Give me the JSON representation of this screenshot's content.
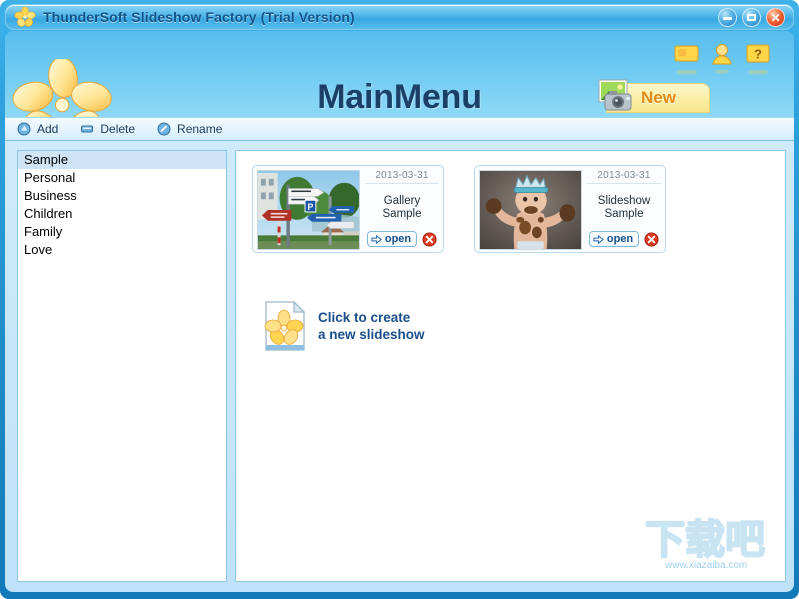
{
  "window": {
    "title": "ThunderSoft Slideshow Factory (Trial Version)",
    "logo_icon": "flower-logo-icon",
    "controls": {
      "minimize": "minimize-button",
      "maximize": "maximize-button",
      "close": "close-button"
    }
  },
  "header": {
    "title": "MainMenu",
    "logo_icon": "flower-logo-large-icon",
    "icons": [
      {
        "name": "notes-icon",
        "label": "Notes"
      },
      {
        "name": "user-icon",
        "label": "User"
      },
      {
        "name": "help-icon",
        "label": "?"
      }
    ],
    "new_button": {
      "label": "New",
      "icon": "photo-camera-icon"
    }
  },
  "toolbar": {
    "items": [
      {
        "label": "Add",
        "icon": "add-icon"
      },
      {
        "label": "Delete",
        "icon": "delete-icon"
      },
      {
        "label": "Rename",
        "icon": "rename-icon"
      }
    ]
  },
  "sidebar": {
    "items": [
      {
        "label": "Sample",
        "selected": true
      },
      {
        "label": "Personal",
        "selected": false
      },
      {
        "label": "Business",
        "selected": false
      },
      {
        "label": "Children",
        "selected": false
      },
      {
        "label": "Family",
        "selected": false
      },
      {
        "label": "Love",
        "selected": false
      }
    ]
  },
  "content": {
    "cards": [
      {
        "date": "2013-03-31",
        "title": "Gallery\nSample",
        "open_label": "open",
        "thumbnail": "street-signpost-photo"
      },
      {
        "date": "2013-03-31",
        "title": "Slideshow\nSample",
        "open_label": "open",
        "thumbnail": "baby-with-crown-photo"
      }
    ],
    "create_new": {
      "text": "Click to create\na new slideshow",
      "icon": "new-document-flower-icon"
    }
  },
  "watermark": {
    "text": "下载吧",
    "url": "www.xiazaiba.com"
  },
  "colors": {
    "title_bar_text": "#12548c",
    "header_title": "#1b3f66",
    "accent_blue": "#1a4f8c",
    "new_button_text": "#e38b18",
    "selection": "#cfe4f5",
    "panel_border": "#8dc6e6",
    "close_red": "#cc2a10"
  }
}
